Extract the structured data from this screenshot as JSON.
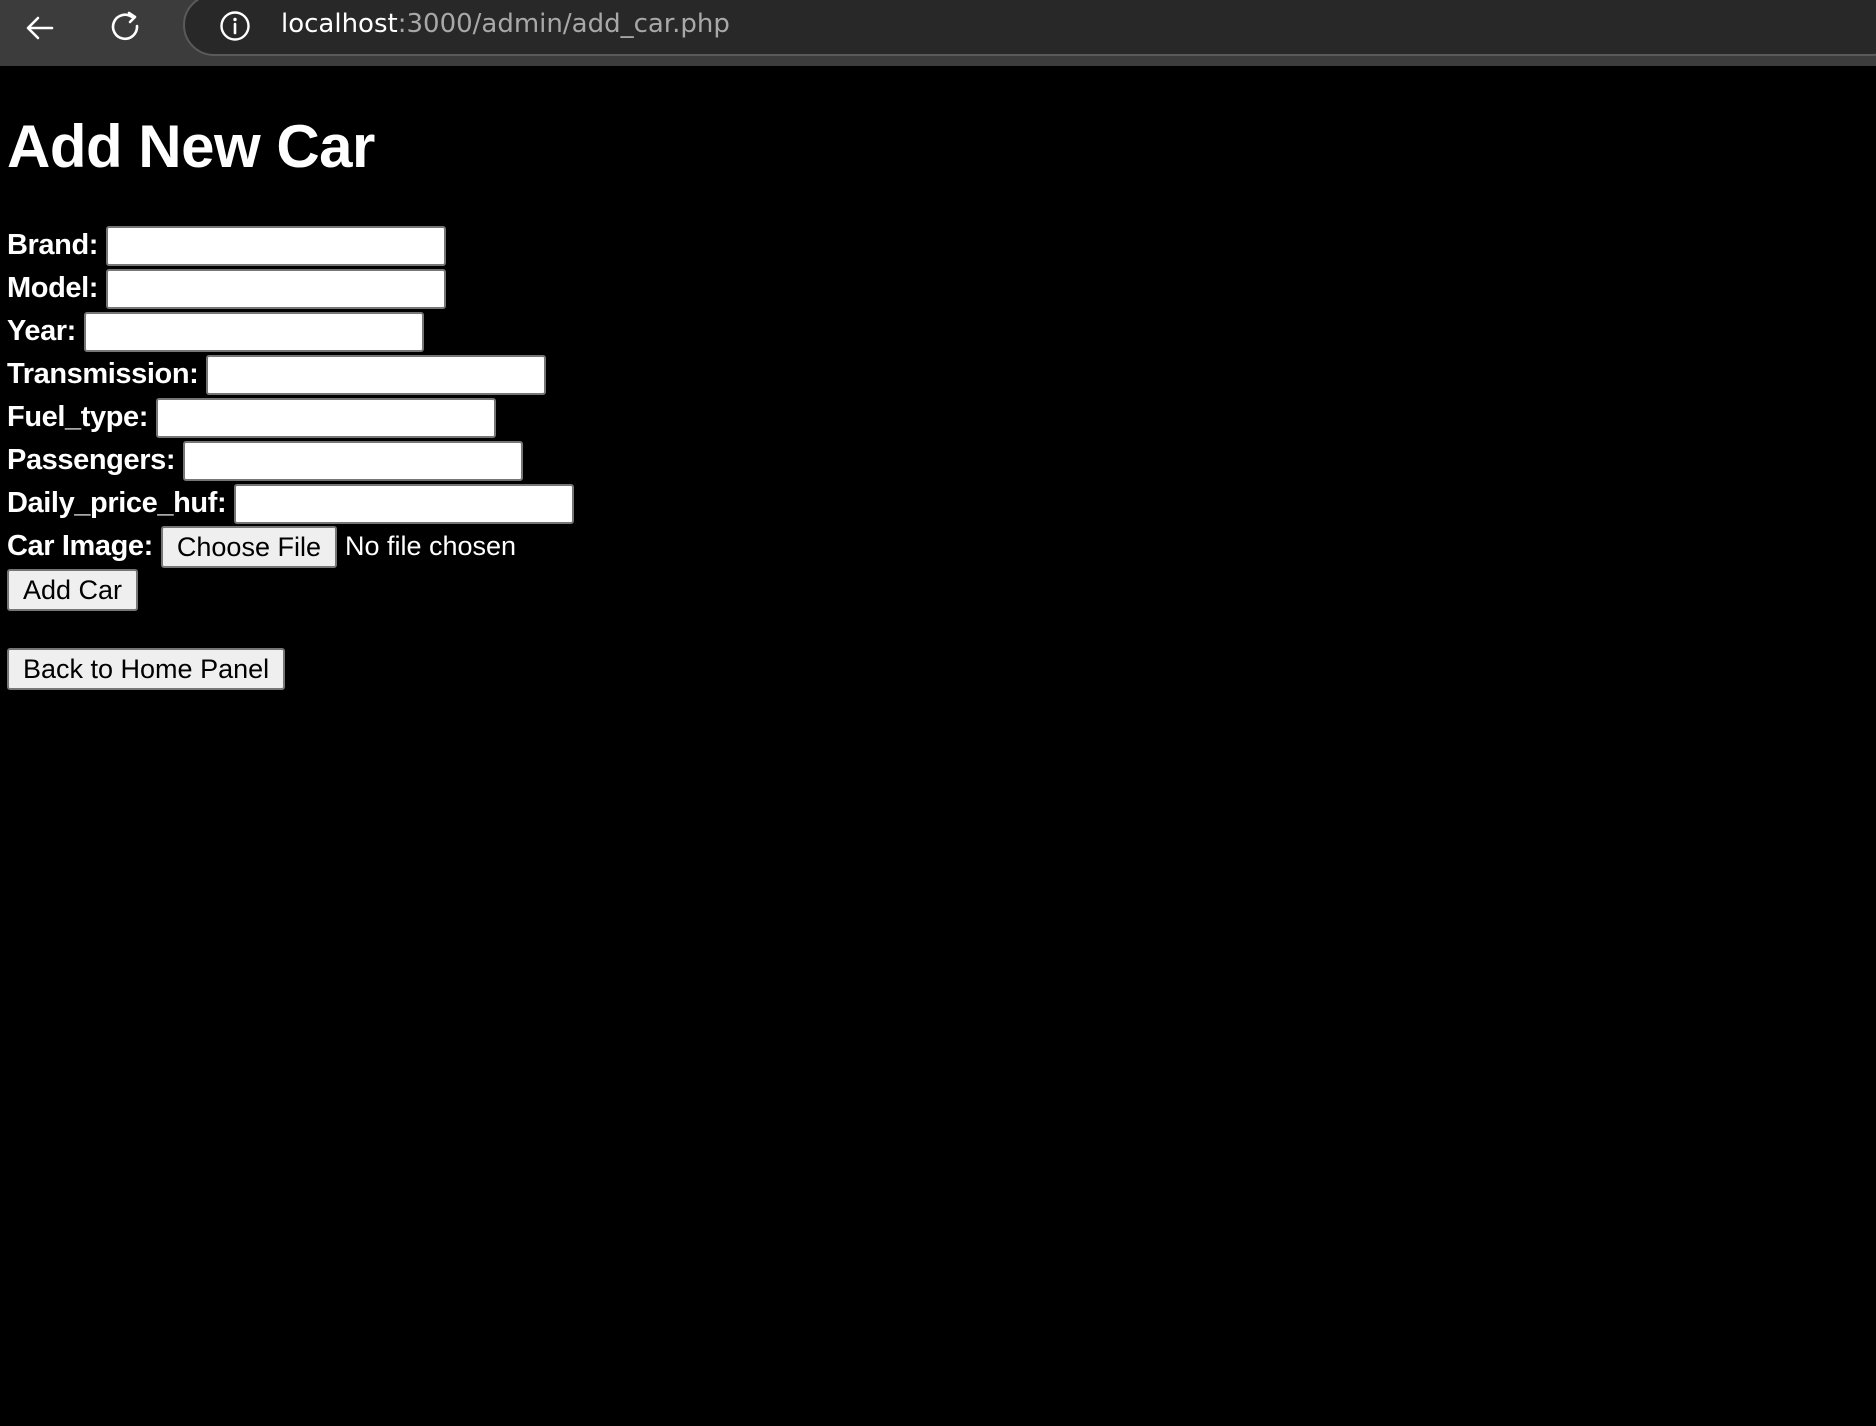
{
  "browser": {
    "url_host": "localhost",
    "url_path": ":3000/admin/add_car.php",
    "icons": {
      "back": "arrow-left-icon",
      "reload": "reload-icon",
      "info": "info-icon"
    }
  },
  "page": {
    "title": "Add New Car",
    "fields": [
      {
        "label": "Brand:",
        "value": ""
      },
      {
        "label": "Model:",
        "value": ""
      },
      {
        "label": "Year:",
        "value": ""
      },
      {
        "label": "Transmission:",
        "value": ""
      },
      {
        "label": "Fuel_type:",
        "value": ""
      },
      {
        "label": "Passengers:",
        "value": ""
      },
      {
        "label": "Daily_price_huf:",
        "value": ""
      }
    ],
    "image_field": {
      "label": "Car Image:",
      "button_label": "Choose File",
      "status": "No file chosen"
    },
    "submit_label": "Add Car",
    "back_label": "Back to Home Panel"
  },
  "colors": {
    "page_background": "#000000",
    "chrome_background": "#3c3c3c",
    "text": "#ffffff",
    "button_background": "#efefef"
  }
}
